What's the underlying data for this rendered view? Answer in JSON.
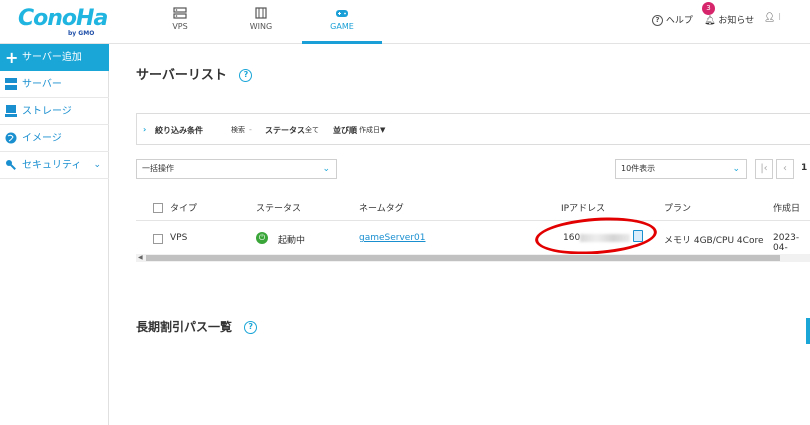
{
  "brand": {
    "logo": "ConoHa",
    "logo_sub": "by GMO"
  },
  "nav": {
    "tabs": [
      {
        "label": "VPS",
        "icon": "server-icon"
      },
      {
        "label": "WING",
        "icon": "building-icon"
      },
      {
        "label": "GAME",
        "icon": "gamepad-icon",
        "active": true
      }
    ],
    "help": "ヘルプ",
    "notifications": "お知らせ",
    "notification_count": "3",
    "user": "l"
  },
  "sidebar": {
    "add_button": "サーバー追加",
    "items": [
      {
        "label": "サーバー",
        "icon": "server-icon"
      },
      {
        "label": "ストレージ",
        "icon": "storage-icon"
      },
      {
        "label": "イメージ",
        "icon": "globe-icon"
      },
      {
        "label": "セキュリティ",
        "icon": "key-icon"
      }
    ]
  },
  "main": {
    "title": "サーバーリスト",
    "filter": {
      "toggle": "絞り込み条件",
      "search_label": "検索",
      "search_value": "-",
      "status_label": "ステータス",
      "status_value": "全て",
      "sort_label": "並び順",
      "sort_value": "作成日▼"
    },
    "bulk_action": "一括操作",
    "page_size": "10件表示",
    "page_number": "1",
    "table": {
      "headers": [
        "タイプ",
        "ステータス",
        "ネームタグ",
        "IPアドレス",
        "プラン",
        "作成日"
      ],
      "rows": [
        {
          "type": "VPS",
          "status": "起動中",
          "name_tag": "gameServer01",
          "ip_prefix": "160",
          "plan": "メモリ 4GB/CPU 4Core",
          "created": "2023-04-"
        }
      ]
    },
    "section2_title": "長期割引パス一覧"
  },
  "colors": {
    "accent": "#1ba6d8",
    "running": "#3aa63a",
    "highlight": "#e20000",
    "badge": "#d6256b"
  }
}
